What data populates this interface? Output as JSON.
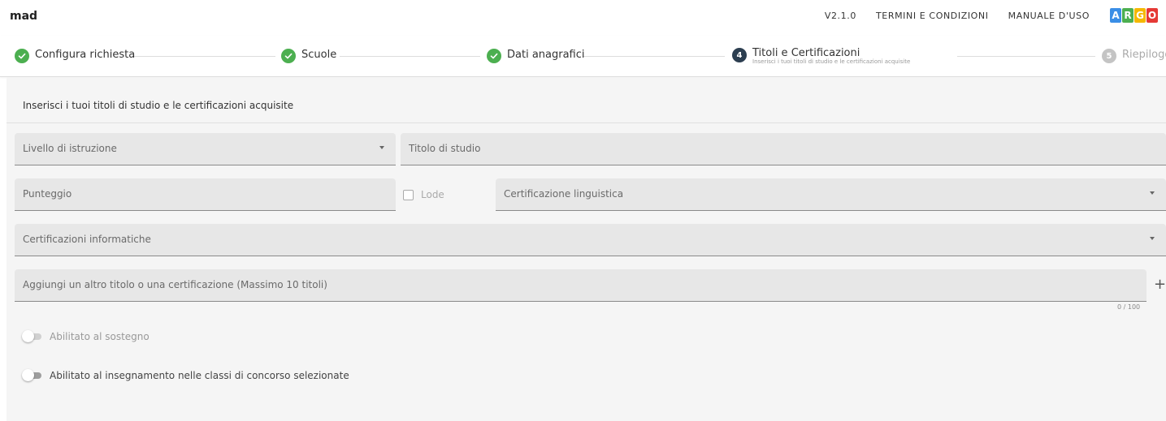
{
  "header": {
    "brand": "mad",
    "version": "V2.1.0",
    "terms": "TERMINI E CONDIZIONI",
    "manual": "MANUALE D'USO",
    "logo_letters": [
      {
        "letter": "A",
        "color": "#3a8ee6"
      },
      {
        "letter": "R",
        "color": "#4caf50"
      },
      {
        "letter": "G",
        "color": "#f5b800"
      },
      {
        "letter": "O",
        "color": "#e53935"
      }
    ]
  },
  "stepper": {
    "steps": [
      {
        "number": "",
        "label": "Configura richiesta",
        "state": "done"
      },
      {
        "number": "",
        "label": "Scuole",
        "state": "done"
      },
      {
        "number": "",
        "label": "Dati anagrafici",
        "state": "done"
      },
      {
        "number": "4",
        "label": "Titoli e Certificazioni",
        "sub": "Inserisci i tuoi titoli di studio e le certificazioni acquisite",
        "state": "active"
      },
      {
        "number": "5",
        "label": "Riepilogo",
        "state": "todo"
      }
    ]
  },
  "form": {
    "title": "Inserisci i tuoi titoli di studio e le certificazioni acquisite",
    "livello_placeholder": "Livello di istruzione",
    "titolo_placeholder": "Titolo di studio",
    "punteggio_placeholder": "Punteggio",
    "lode_label": "Lode",
    "lode_checked": false,
    "cert_ling_placeholder": "Certificazione linguistica",
    "cert_info_placeholder": "Certificazioni informatiche",
    "altro_placeholder": "Aggiungi un altro titolo o una certificazione (Massimo 10 titoli)",
    "altro_counter": "0 / 100",
    "add_symbol": "+",
    "toggle_sostegno": {
      "label": "Abilitato al sostegno",
      "on": false,
      "disabled": true
    },
    "toggle_insegnamento": {
      "label": "Abilitato al insegnamento nelle classi di concorso selezionate",
      "on": false,
      "disabled": false
    }
  },
  "colors": {
    "done": "#4caf50",
    "active": "#2c3e50",
    "todo": "#c4c4c4"
  }
}
